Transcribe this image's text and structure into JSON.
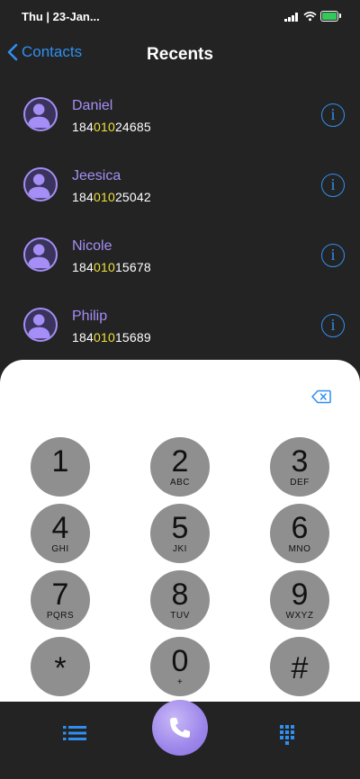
{
  "status_bar": {
    "time": "Thu | 23-Jan..."
  },
  "nav": {
    "back_label": "Contacts",
    "title": "Recents"
  },
  "recents": [
    {
      "name": "Daniel",
      "num_pre": "184",
      "num_hl": "010",
      "num_post": "24685"
    },
    {
      "name": "Jeesica",
      "num_pre": "184",
      "num_hl": "010",
      "num_post": "25042"
    },
    {
      "name": "Nicole",
      "num_pre": "184",
      "num_hl": "010",
      "num_post": "15678"
    },
    {
      "name": "Philip",
      "num_pre": "184",
      "num_hl": "010",
      "num_post": "15689"
    }
  ],
  "dialpad": {
    "keys": [
      {
        "digit": "1",
        "letters": ""
      },
      {
        "digit": "2",
        "letters": "ABC"
      },
      {
        "digit": "3",
        "letters": "DEF"
      },
      {
        "digit": "4",
        "letters": "GHI"
      },
      {
        "digit": "5",
        "letters": "JKI"
      },
      {
        "digit": "6",
        "letters": "MNO"
      },
      {
        "digit": "7",
        "letters": "PQRS"
      },
      {
        "digit": "8",
        "letters": "TUV"
      },
      {
        "digit": "9",
        "letters": "WXYZ"
      },
      {
        "digit": "*",
        "letters": ""
      },
      {
        "digit": "0",
        "letters": "+"
      },
      {
        "digit": "#",
        "letters": ""
      }
    ]
  },
  "icons": {
    "back": "chevron-left-icon",
    "info": "info-icon",
    "avatar": "person-icon",
    "backspace": "backspace-icon",
    "call": "phone-icon",
    "recents_tab": "list-icon",
    "keypad_tab": "keypad-grid-icon"
  },
  "colors": {
    "background": "#232323",
    "accent_blue": "#2f8ff0",
    "accent_purple": "#a58ef5",
    "highlight_yellow": "#f0e03a",
    "key_gray": "#8f8f8f"
  }
}
